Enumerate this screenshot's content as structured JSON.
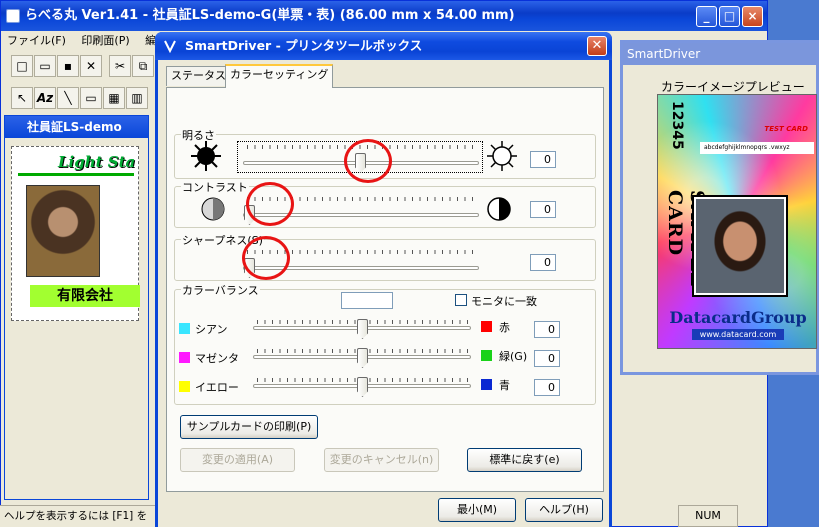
{
  "main_window": {
    "title": "らべる丸 Ver1.41 - 社員証LS-demo-G(単票・表) (86.00 mm x 54.00 mm)",
    "menu": [
      "ファイル(F)",
      "印刷面(P)",
      "編集"
    ],
    "doc_title": "社員証LS-demo",
    "card_logo": "Light Sta",
    "card_company": "有限会社",
    "status_text": "ヘルプを表示するには [F1] を",
    "num_indicator": "NUM"
  },
  "preview": {
    "title": "SmartDriver",
    "label": "カラーイメージプレビュー",
    "card": {
      "id_text": "12345",
      "test_label": "TEST CARD",
      "strip_text": "abcdefghijklmnopqrs .vwxyz",
      "vertical_text": "SAMPLE CARD",
      "brand": "DatacardGroup",
      "url": "www.datacard.com"
    }
  },
  "dialog": {
    "title": "SmartDriver - プリンタツールボックス",
    "tabs": [
      "ステータス",
      "カラーセッティング"
    ],
    "brightness": {
      "label": "明るさ",
      "value": "0",
      "level": 0.5
    },
    "contrast": {
      "label": "コントラスト",
      "value": "0",
      "level": 0.0
    },
    "sharpness": {
      "label": "シャープネス(S)",
      "value": "0",
      "level": 0.0
    },
    "color_balance": {
      "label": "カラーバランス",
      "monitor_match_label": "モニタに一致",
      "rows": [
        {
          "left": "シアン",
          "right": "赤",
          "left_color": "#39e6ff",
          "right_color": "#ff0000",
          "value": "0",
          "level": 0.5
        },
        {
          "left": "マゼンタ",
          "right": "緑(G)",
          "left_color": "#ff19ff",
          "right_color": "#19d219",
          "value": "0",
          "level": 0.5
        },
        {
          "left": "イエロー",
          "right": "青",
          "left_color": "#ffff00",
          "right_color": "#0a28d2",
          "value": "0",
          "level": 0.5
        }
      ]
    },
    "buttons": {
      "print_sample": "サンプルカードの印刷(P)",
      "apply": "変更の適用(A)",
      "cancel_changes": "変更のキャンセル(n)",
      "reset": "標準に戻す(e)",
      "minimize": "最小(M)",
      "help": "ヘルプ(H)"
    }
  }
}
